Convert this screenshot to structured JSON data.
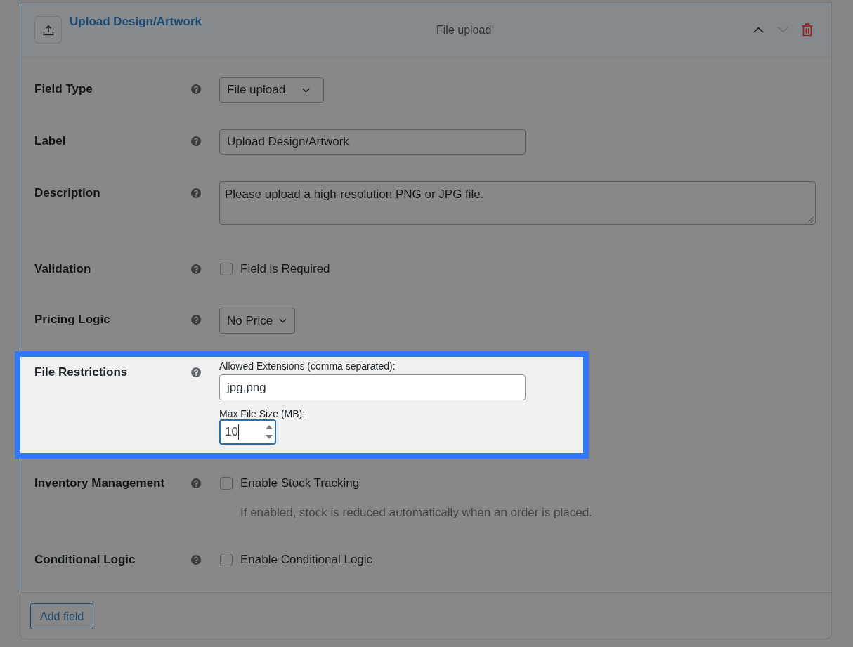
{
  "field": {
    "title": "Upload Design/Artwork",
    "type_label": "File upload",
    "move_up_disabled": false,
    "move_down_disabled": true
  },
  "settings": [
    {
      "kind": "select",
      "label": "Field Type",
      "value": "File upload",
      "highlighted": false
    },
    {
      "kind": "text",
      "label": "Label",
      "value": "Upload Design/Artwork",
      "highlighted": false
    },
    {
      "kind": "textarea",
      "label": "Description",
      "value": "Please upload a high-resolution PNG or JPG file.",
      "highlighted": false
    },
    {
      "kind": "checkbox",
      "label": "Validation",
      "option": "Field is Required",
      "checked": false,
      "highlighted": false
    },
    {
      "kind": "select",
      "label": "Pricing Logic",
      "value": "No Price",
      "highlighted": false
    },
    {
      "kind": "restrictions",
      "label": "File Restrictions",
      "highlighted": true,
      "extensions": {
        "label": "Allowed Extensions (comma separated):",
        "value": "jpg,png"
      },
      "max_size": {
        "label": "Max File Size (MB):",
        "value": "10",
        "focused": true
      }
    },
    {
      "kind": "checkbox",
      "label": "Inventory Management",
      "option": "Enable Stock Tracking",
      "checked": false,
      "note": "If enabled, stock is reduced automatically when an order is placed.",
      "highlighted": false
    },
    {
      "kind": "checkbox",
      "label": "Conditional Logic",
      "option": "Enable Conditional Logic",
      "checked": false,
      "highlighted": false
    }
  ],
  "footer": {
    "add_button": "Add field"
  }
}
